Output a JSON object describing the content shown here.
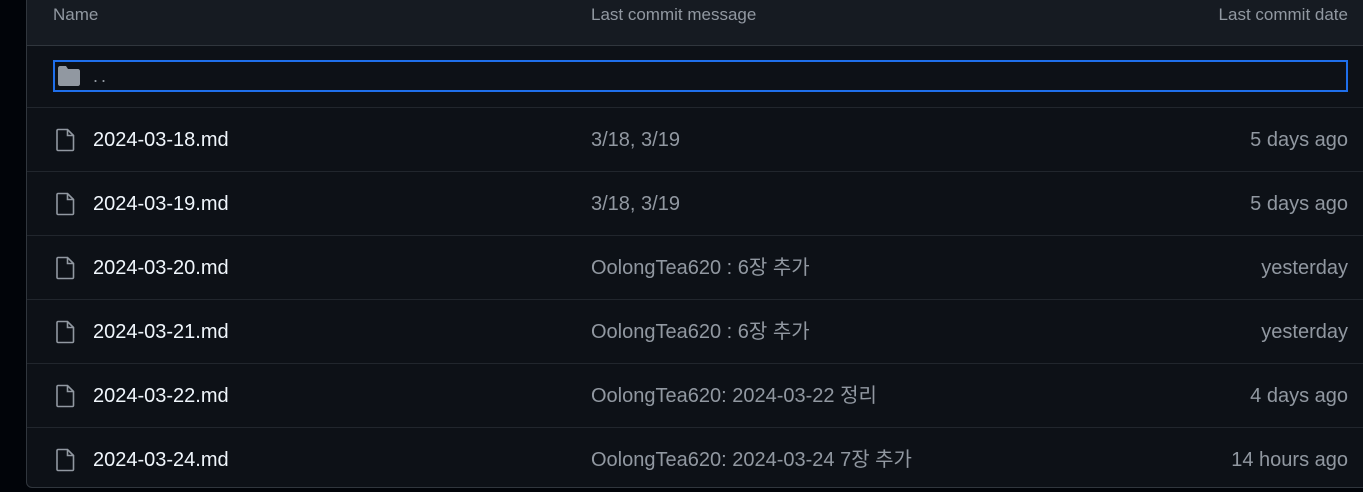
{
  "header": {
    "name": "Name",
    "message": "Last commit message",
    "date": "Last commit date"
  },
  "parent": {
    "label": "..",
    "icon": "folder-icon"
  },
  "files": [
    {
      "name": "2024-03-18.md",
      "message": "3/18, 3/19",
      "date": "5 days ago"
    },
    {
      "name": "2024-03-19.md",
      "message": "3/18, 3/19",
      "date": "5 days ago"
    },
    {
      "name": "2024-03-20.md",
      "message": "OolongTea620 : 6장 추가",
      "date": "yesterday"
    },
    {
      "name": "2024-03-21.md",
      "message": "OolongTea620 : 6장 추가",
      "date": "yesterday"
    },
    {
      "name": "2024-03-22.md",
      "message": "OolongTea620: 2024-03-22 정리",
      "date": "4 days ago"
    },
    {
      "name": "2024-03-24.md",
      "message": "OolongTea620: 2024-03-24 7장 추가",
      "date": "14 hours ago"
    }
  ],
  "colors": {
    "background": "#0d1117",
    "header_bg": "#161b22",
    "focus_ring": "#1f6feb",
    "text_primary": "#f0f6fc",
    "text_muted": "#9198a1"
  }
}
